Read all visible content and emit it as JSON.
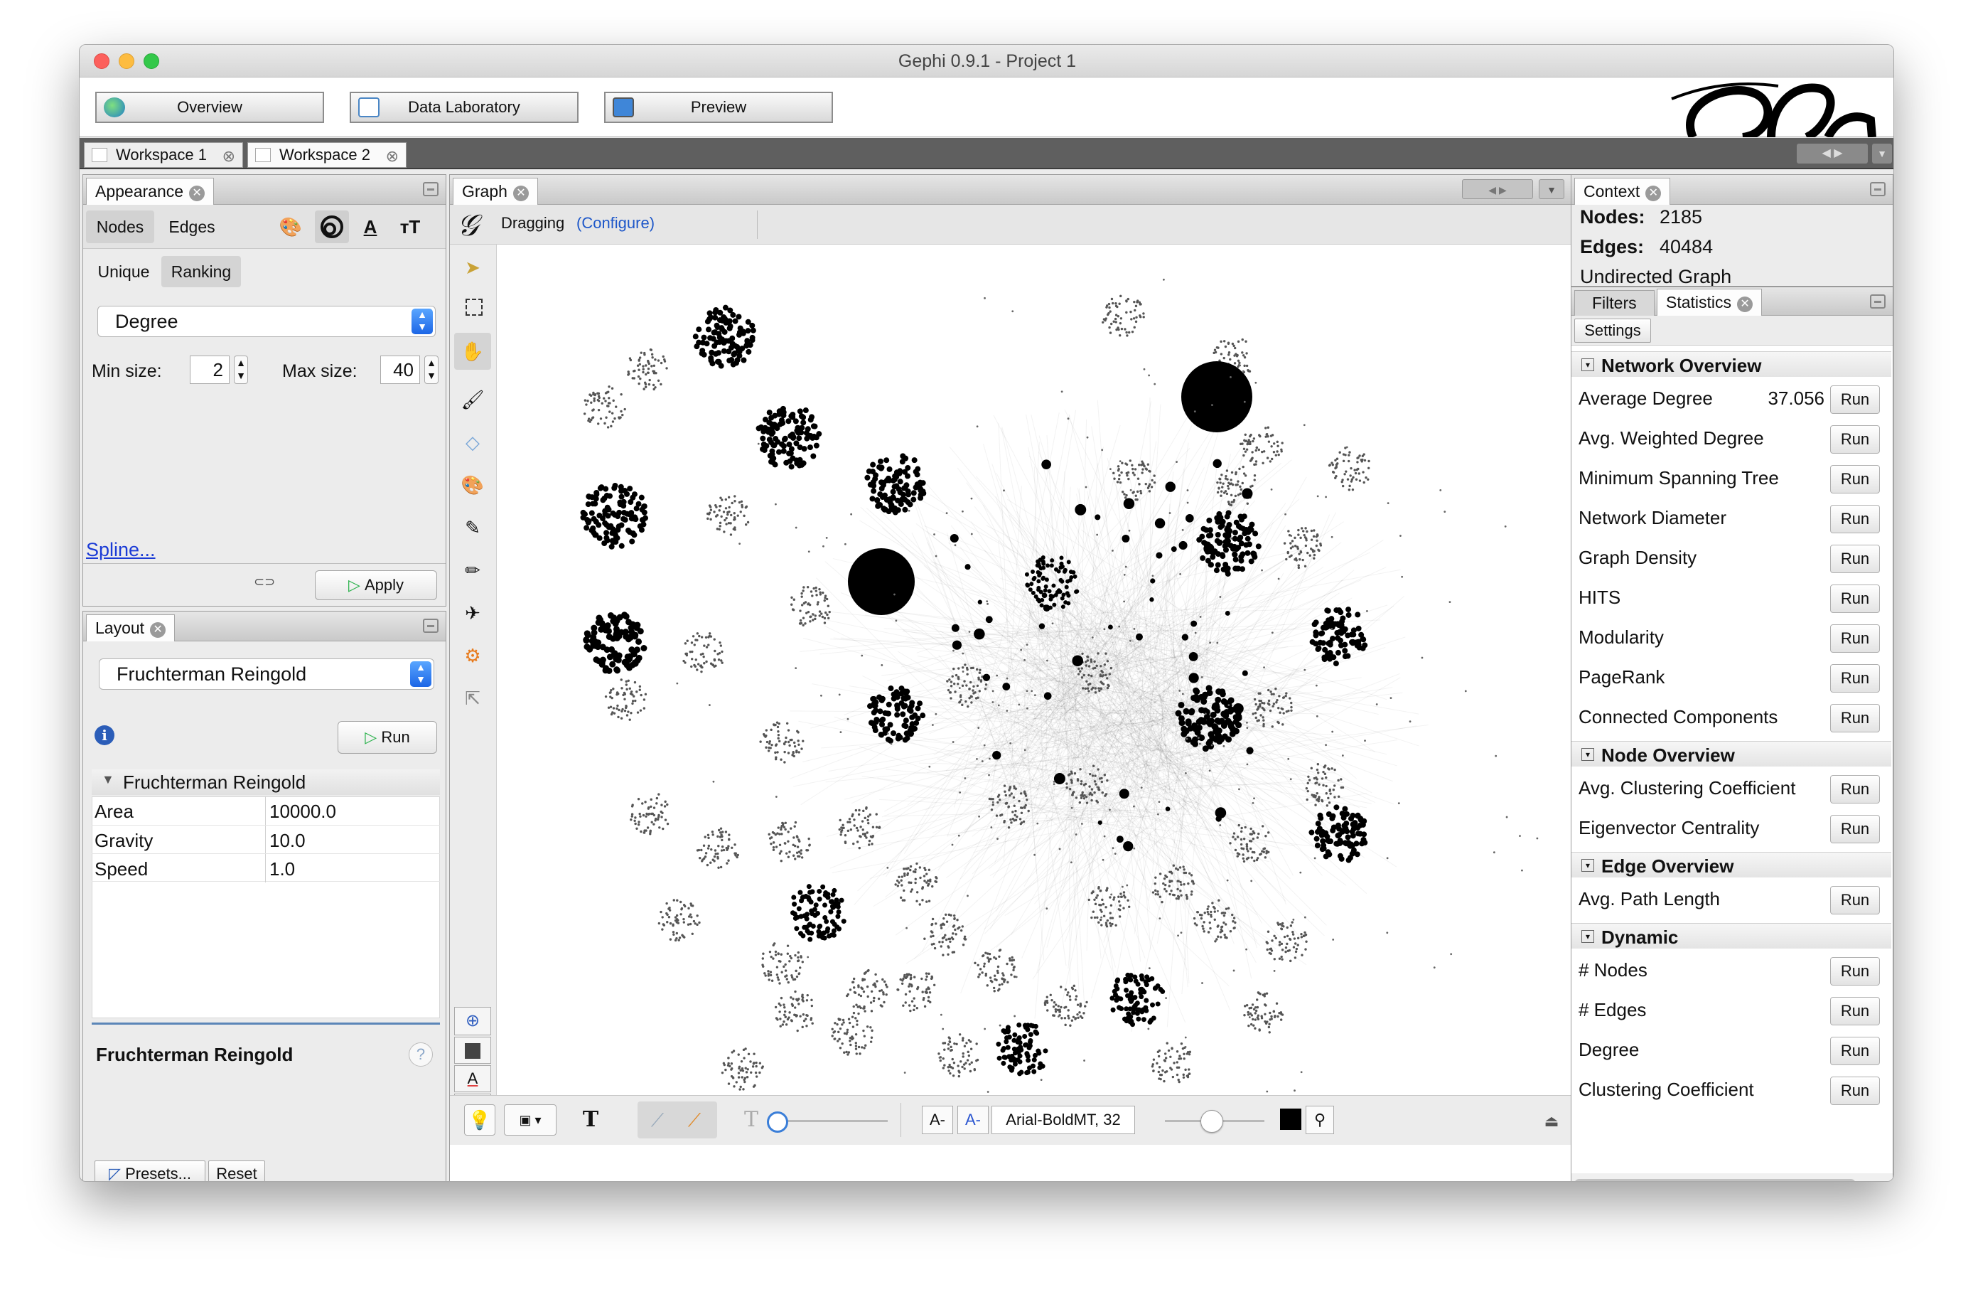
{
  "window": {
    "title": "Gephi 0.9.1 - Project 1"
  },
  "modes": [
    {
      "label": "Overview",
      "icon": "globe-icon"
    },
    {
      "label": "Data Laboratory",
      "icon": "table-icon"
    },
    {
      "label": "Preview",
      "icon": "monitor-icon"
    }
  ],
  "workspaces": [
    {
      "label": "Workspace 1"
    },
    {
      "label": "Workspace 2"
    }
  ],
  "appearance": {
    "title": "Appearance",
    "tabs": [
      "Nodes",
      "Edges"
    ],
    "modes": [
      "Unique",
      "Ranking"
    ],
    "attribute": "Degree",
    "min_label": "Min size:",
    "min_value": "2",
    "max_label": "Max size:",
    "max_value": "40",
    "spline": "Spline...",
    "apply": "Apply"
  },
  "layout": {
    "title": "Layout",
    "algorithm": "Fruchterman Reingold",
    "run": "Run",
    "section": "Fruchterman Reingold",
    "properties": [
      {
        "name": "Area",
        "value": "10000.0"
      },
      {
        "name": "Gravity",
        "value": "10.0"
      },
      {
        "name": "Speed",
        "value": "1.0"
      }
    ],
    "desc_title": "Fruchterman Reingold",
    "presets": "Presets...",
    "reset": "Reset"
  },
  "graph": {
    "title": "Graph",
    "mode": "Dragging",
    "configure": "(Configure)",
    "font": "Arial-BoldMT, 32"
  },
  "context": {
    "title": "Context",
    "nodes_label": "Nodes:",
    "nodes": "2185",
    "edges_label": "Edges:",
    "edges": "40484",
    "type": "Undirected Graph"
  },
  "statistics": {
    "tabs": [
      "Filters",
      "Statistics"
    ],
    "settings": "Settings",
    "run": "Run",
    "sections": [
      {
        "title": "Network Overview",
        "items": [
          {
            "label": "Average Degree",
            "value": "37.056"
          },
          {
            "label": "Avg. Weighted Degree"
          },
          {
            "label": "Minimum Spanning Tree"
          },
          {
            "label": "Network Diameter"
          },
          {
            "label": "Graph Density"
          },
          {
            "label": "HITS"
          },
          {
            "label": "Modularity"
          },
          {
            "label": "PageRank"
          },
          {
            "label": "Connected Components"
          }
        ]
      },
      {
        "title": "Node Overview",
        "items": [
          {
            "label": "Avg. Clustering Coefficient"
          },
          {
            "label": "Eigenvector Centrality"
          }
        ]
      },
      {
        "title": "Edge Overview",
        "items": [
          {
            "label": "Avg. Path Length"
          }
        ]
      },
      {
        "title": "Dynamic",
        "items": [
          {
            "label": "# Nodes"
          },
          {
            "label": "# Edges"
          },
          {
            "label": "Degree"
          },
          {
            "label": "Clustering Coefficient"
          }
        ]
      }
    ]
  }
}
